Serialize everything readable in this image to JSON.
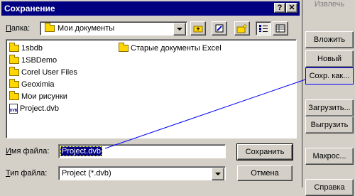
{
  "dialog": {
    "title": "Сохранение",
    "help_label": "?",
    "close_label": "✕",
    "folder_label": "Папка:",
    "folder_value": "Мои документы",
    "files": [
      {
        "name": "1sbdb",
        "type": "folder"
      },
      {
        "name": "1SBDemo",
        "type": "folder"
      },
      {
        "name": "Corel User Files",
        "type": "folder"
      },
      {
        "name": "Geoximia",
        "type": "folder"
      },
      {
        "name": "Мои рисунки",
        "type": "folder"
      },
      {
        "name": "Project.dvb",
        "type": "file"
      },
      {
        "name": "Старые документы Excel",
        "type": "folder"
      }
    ],
    "filename_label": "Имя файла:",
    "filename_value": "Project.dvb",
    "filetype_label": "Тип файла:",
    "filetype_value": "Project (*.dvb)",
    "save_button": "Сохранить",
    "cancel_button": "Отмена"
  },
  "side_panel": {
    "top_label": "Извлечь",
    "buttons": [
      "Вложить",
      "Новый",
      "Сохр. как...",
      "Загрузить...",
      "Выгрузить",
      "Макрос...",
      "Справка"
    ]
  },
  "colors": {
    "titlebar": "#000080",
    "annotation_line": "#0000ff",
    "folder": "#ffd700"
  }
}
